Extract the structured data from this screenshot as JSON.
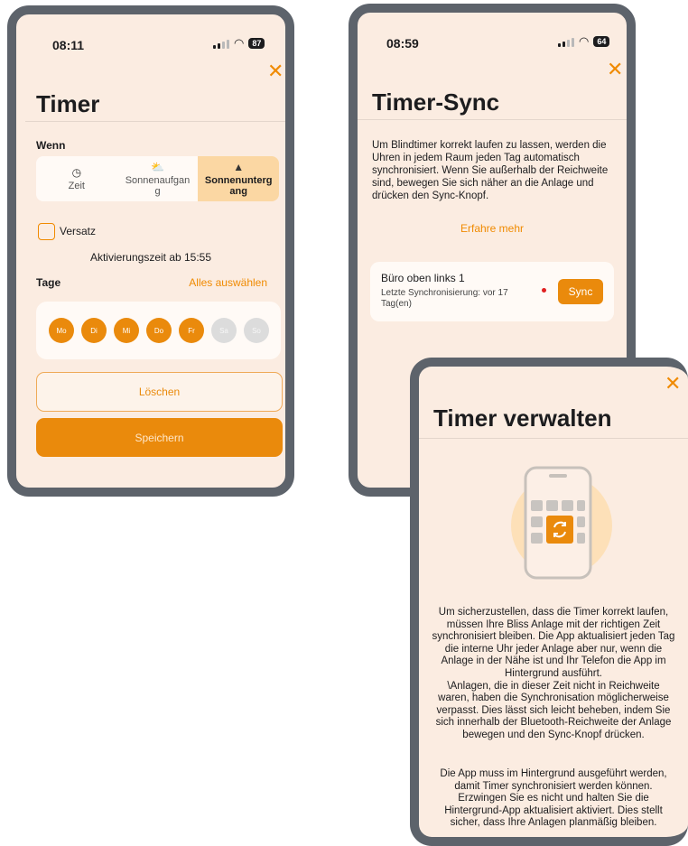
{
  "phone1": {
    "time": "08:11",
    "battery": "87",
    "close": "✕",
    "title": "Timer",
    "wenn_label": "Wenn",
    "options": [
      {
        "label": "Zeit",
        "icon": "clock-icon"
      },
      {
        "label": "Sonnenaufgan\ng",
        "icon": "sunrise-icon"
      },
      {
        "label": "Sonnenunterg\nang",
        "icon": "sunset-icon",
        "selected": true
      }
    ],
    "versatz": "Versatz",
    "activation": "Aktivierungszeit ab 15:55",
    "tage_label": "Tage",
    "select_all": "Alles auswählen",
    "days": [
      {
        "label": "Mo",
        "active": true
      },
      {
        "label": "Di",
        "active": true
      },
      {
        "label": "Mi",
        "active": true
      },
      {
        "label": "Do",
        "active": true
      },
      {
        "label": "Fr",
        "active": true
      },
      {
        "label": "Sa",
        "active": false
      },
      {
        "label": "So",
        "active": false
      }
    ],
    "delete_label": "Löschen",
    "save_label": "Speichern"
  },
  "phone2": {
    "time": "08:59",
    "battery": "64",
    "close": "✕",
    "title": "Timer-Sync",
    "description": "Um Blindtimer korrekt laufen zu lassen, werden die Uhren in jedem Raum jeden Tag automatisch synchronisiert. Wenn Sie außerhalb der Reichweite sind, bewegen Sie sich näher an die Anlage und drücken den Sync-Knopf.",
    "learn_more": "Erfahre mehr",
    "device_name": "Büro oben links 1",
    "last_sync": "Letzte Synchronisierung: vor 17 Tag(en)",
    "sync_label": "Sync"
  },
  "phone3": {
    "close": "✕",
    "title": "Timer verwalten",
    "body1": "Um sicherzustellen, dass die Timer korrekt laufen, müssen Ihre Bliss Anlage mit der richtigen Zeit synchronisiert bleiben. Die App aktualisiert jeden Tag die interne Uhr jeder Anlage aber nur, wenn die Anlage in der Nähe ist und Ihr Telefon die App im Hintergrund ausführt.",
    "body2": "\\Anlagen, die in dieser Zeit nicht in Reichweite waren, haben die Synchronisation möglicherweise verpasst. Dies lässt sich leicht beheben, indem Sie sich innerhalb der Bluetooth-Reichweite der Anlage bewegen und den Sync-Knopf drücken.",
    "body3": "Die App muss im Hintergrund ausgeführt werden, damit Timer synchronisiert werden können. Erzwingen Sie es nicht und halten Sie die Hintergrund-App aktualisiert aktiviert. Dies stellt sicher, dass Ihre Anlagen planmäßig bleiben."
  },
  "colors": {
    "accent": "#ea8a0c",
    "background": "#fbece1",
    "frame": "#5d636b"
  }
}
